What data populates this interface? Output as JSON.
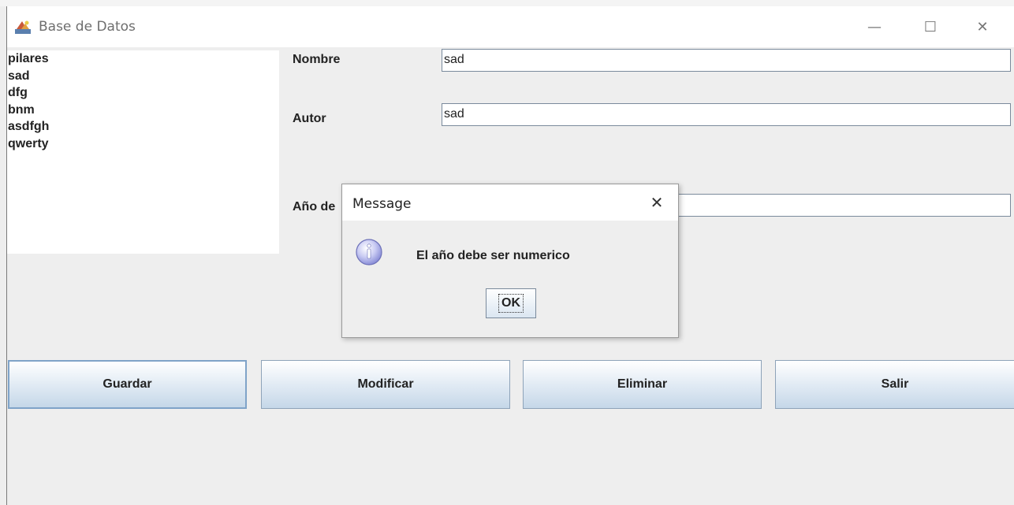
{
  "window": {
    "title": "Base de Datos",
    "controls": {
      "minimize": "—",
      "maximize": "☐",
      "close": "✕"
    }
  },
  "list": {
    "items": [
      "pilares",
      "sad",
      "dfg",
      "bnm",
      "asdfgh",
      "qwerty"
    ]
  },
  "form": {
    "nombre_label": "Nombre",
    "nombre_value": "sad",
    "autor_label": "Autor",
    "autor_value": "sad",
    "anio_label_visible": "Año de",
    "anio_value": ""
  },
  "buttons": {
    "guardar": "Guardar",
    "modificar": "Modificar",
    "eliminar": "Eliminar",
    "salir": "Salir"
  },
  "dialog": {
    "title": "Message",
    "close": "✕",
    "icon": "info-icon",
    "message": "El año debe ser numerico",
    "ok_label": "OK"
  },
  "colors": {
    "window_bg": "#eeeeee",
    "button_top": "#ffffff",
    "button_bottom": "#c5d7e8",
    "icon_purple": "#8b8fd8"
  }
}
